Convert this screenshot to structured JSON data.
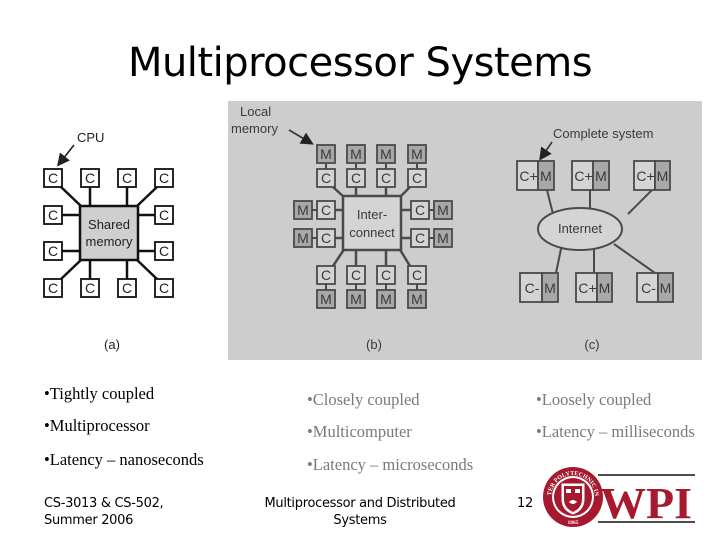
{
  "slide": {
    "title": "Multiprocessor Systems",
    "page_number": "12"
  },
  "figure": {
    "panel_a": {
      "caption": "(a)",
      "callout": "CPU",
      "center_label_line1": "Shared",
      "center_label_line2": "memory",
      "node_label": "C"
    },
    "panel_b": {
      "caption": "(b)",
      "callout_line1": "Local",
      "callout_line2": "memory",
      "center_label_line1": "Inter-",
      "center_label_line2": "connect",
      "cpu_label": "C",
      "memory_label": "M"
    },
    "panel_c": {
      "caption": "(c)",
      "callout": "Complete system",
      "center_label": "Internet",
      "node_cpu_labels": [
        "C+",
        "C+",
        "C+",
        "C-",
        "C+",
        "C-"
      ],
      "node_memory_label": "M"
    }
  },
  "columns": [
    {
      "style": "emphasized",
      "items": [
        "•Tightly coupled",
        "•Multiprocessor",
        "•Latency – nanoseconds"
      ]
    },
    {
      "style": "dimmed",
      "items": [
        "•Closely coupled",
        "•Multicomputer",
        "•Latency – microseconds"
      ]
    },
    {
      "style": "dimmed",
      "items": [
        "•Loosely coupled",
        "•Latency – milliseconds"
      ]
    }
  ],
  "footer": {
    "course_line1": "CS-3013 & CS-502,",
    "course_line2": "Summer 2006",
    "topic_line1": "Multiprocessor and Distributed",
    "topic_line2": "Systems"
  },
  "logo": {
    "text": "WPI",
    "seal_top_text": "WORCESTER POLYTECHNIC INSTITUTE",
    "seal_year": "1865",
    "brand_color": "#a6192e"
  },
  "colors": {
    "panel_background": "#cdcdcd",
    "dimmed_text": "#7a7a7a",
    "memory_fill": "#a8a8a8",
    "cpu_fill_b": "#d4d4d4",
    "shared_memory_fill": "#cfcfcf"
  }
}
